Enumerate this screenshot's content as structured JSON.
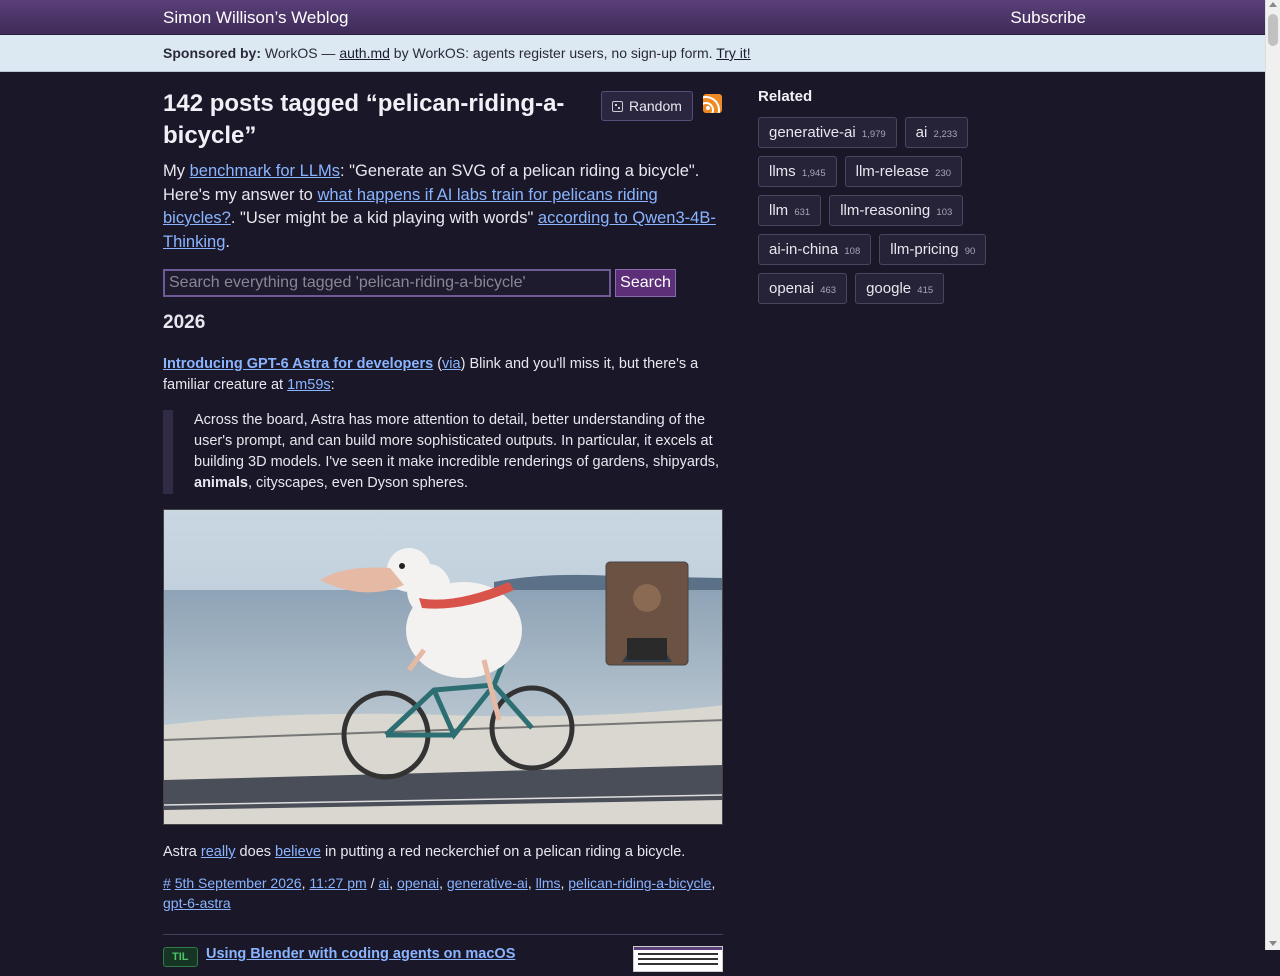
{
  "header": {
    "site_title": "Simon Willison’s Weblog",
    "subscribe_label": "Subscribe"
  },
  "sponsor": {
    "label": "Sponsored by:",
    "text_before": "WorkOS — ",
    "link": "auth.md",
    "text_after": " by WorkOS: agents register users, no sign-up form. ",
    "cta": "Try it!"
  },
  "page": {
    "title": "142 posts tagged “pelican-riding-a-bicycle”",
    "random_label": "Random",
    "rss_icon": "rss-feed-icon",
    "intro": {
      "p1": "My ",
      "link1": "benchmark for LLMs",
      "p2": ": \"Generate an SVG of a pelican riding a bicycle\". Here's my answer to ",
      "link2": "what happens if AI labs train for pelicans riding bicycles?",
      "p3": ". \"User might be a kid playing with words\" ",
      "link3": "according to Qwen3-4B-Thinking",
      "p4": "."
    }
  },
  "search": {
    "placeholder": "Search everything tagged 'pelican-riding-a-bicycle'",
    "button_label": "Search"
  },
  "year": "2026",
  "entry": {
    "title": "Introducing GPT-6 Astra for developers",
    "via_open": " (",
    "via": "via",
    "via_close": ") Blink and you'll miss it, but there's a familiar creature at ",
    "timestamp_link": "1m59s",
    "after_ts": ":",
    "quote_before": "Across the board, Astra has more attention to detail, better understanding of the user's prompt, and can build more sophisticated outputs. In particular, it excels at building 3D models. I've seen it make incredible renderings of gardens, shipyards, ",
    "quote_bold": "animals",
    "quote_after": ", cityscapes, even Dyson spheres.",
    "caption": {
      "c1": "Astra ",
      "l1": "really",
      "c2": " does ",
      "l2": "believe",
      "c3": " in putting a red neckerchief on a pelican riding a bicycle."
    },
    "meta": {
      "hash": "#",
      "date": "5th September 2026",
      "time": "11:27 pm",
      "slash": " / ",
      "tags": [
        "ai",
        "openai",
        "generative-ai",
        "llms",
        "pelican-riding-a-bicycle",
        "gpt-6-astra"
      ]
    }
  },
  "til": {
    "badge": "TIL",
    "title": "Using Blender with coding agents on macOS"
  },
  "sidebar": {
    "title": "Related",
    "tags": [
      {
        "name": "generative-ai",
        "count": "1,979"
      },
      {
        "name": "ai",
        "count": "2,233"
      },
      {
        "name": "llms",
        "count": "1,945"
      },
      {
        "name": "llm-release",
        "count": "230"
      },
      {
        "name": "llm",
        "count": "631"
      },
      {
        "name": "llm-reasoning",
        "count": "103"
      },
      {
        "name": "ai-in-china",
        "count": "108"
      },
      {
        "name": "llm-pricing",
        "count": "90"
      },
      {
        "name": "openai",
        "count": "463"
      },
      {
        "name": "google",
        "count": "415"
      }
    ]
  }
}
